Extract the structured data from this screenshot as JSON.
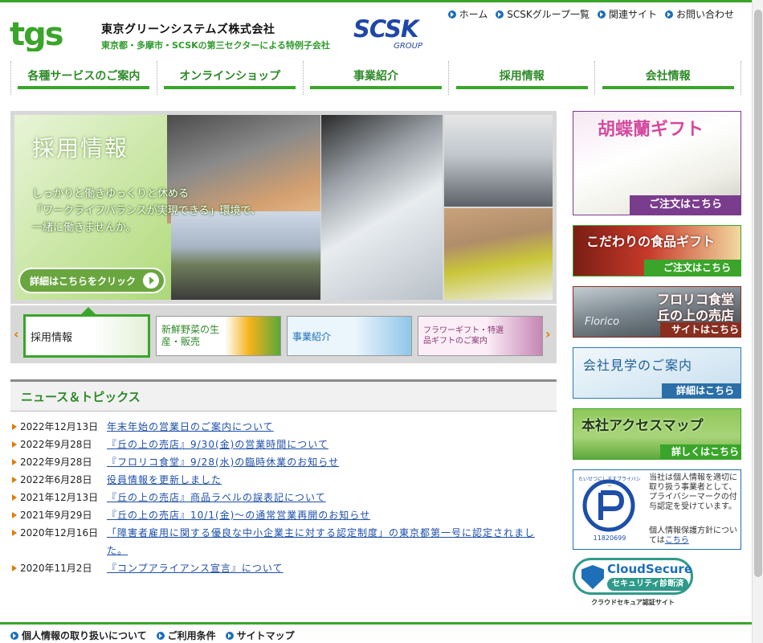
{
  "header": {
    "company_name": "東京グリーンシステムズ株式会社",
    "company_sub": "東京都・多摩市・SCSKの第三セクターによる特例子会社",
    "logo_text": "tgs",
    "group_logo": "SCSK",
    "group_logo_sub": "GROUP",
    "top_links": [
      "ホーム",
      "SCSKグループ一覧",
      "関連サイト",
      "お問い合わせ"
    ]
  },
  "nav": [
    "各種サービスのご案内",
    "オンラインショップ",
    "事業紹介",
    "採用情報",
    "会社情報"
  ],
  "hero": {
    "title": "採用情報",
    "text_line1": "しっかりと働きゆっくりと休める",
    "text_line2": "「ワークライフバランスが実現できる」環境で、",
    "text_line3": "一緒に働きませんか。",
    "button": "詳細はこちらをクリック"
  },
  "carousel": {
    "prev": "‹",
    "next": "›",
    "items": [
      "採用情報",
      "新鮮野菜の生産・販売",
      "事業紹介",
      "フラワーギフト・特選品ギフトのご案内"
    ]
  },
  "news": {
    "heading": "ニュース＆トピックス",
    "items": [
      {
        "date": "2022年12月13日",
        "title": "年末年始の営業日のご案内について"
      },
      {
        "date": "2022年9月28日",
        "title": "『丘の上の売店』9/30(金)の営業時間について"
      },
      {
        "date": "2022年9月28日",
        "title": "『フロリコ食堂』9/28(水)の臨時休業のお知らせ"
      },
      {
        "date": "2022年6月28日",
        "title": "役員情報を更新しました"
      },
      {
        "date": "2021年12月13日",
        "title": "『丘の上の売店』商品ラベルの誤表記について"
      },
      {
        "date": "2021年9月29日",
        "title": "『丘の上の売店』10/1(金)～の通常営業再開のお知らせ"
      },
      {
        "date": "2020年12月16日",
        "title": "「障害者雇用に関する優良な中小企業主に対する認定制度」の東京都第一号に認定されました。"
      },
      {
        "date": "2020年11月2日",
        "title": "『コンプアライアンス宣言』について"
      }
    ]
  },
  "sidebar": {
    "orchid": {
      "title": "胡蝶蘭ギフト",
      "cta": "ご注文はこちら"
    },
    "food": {
      "title": "こだわりの食品ギフト",
      "cta": "ご注文はこちら"
    },
    "florico": {
      "title1": "フロリコ食堂",
      "title2": "丘の上の売店",
      "cta": "サイトはこちら",
      "sign": "Florico"
    },
    "tour": {
      "title": "会社見学のご案内",
      "cta": "詳細はこちら"
    },
    "access": {
      "title": "本社アクセスマップ",
      "cta": "詳しくはこちら"
    },
    "privacy": {
      "mark_text": "たいせつにしますプライバシー",
      "mark_number": "11820699",
      "text1": "当社は個人情報を適切に取り扱う事業者として、プライバシーマークの付与認定を受けています。",
      "text2": "個人情報保護方針については",
      "link": "こちら"
    },
    "cloudsecure": {
      "title": "CloudSecure",
      "badge": "セキュリティ診断済",
      "caption": "クラウドセキュア認証サイト"
    }
  },
  "footer": [
    "個人情報の取り扱いについて",
    "ご利用条件",
    "サイトマップ"
  ],
  "colors": {
    "brand_green": "#3aa52a",
    "link_blue": "#1d4fa8",
    "accent_orange": "#e07b00",
    "orchid_purple": "#7a3c8c"
  }
}
